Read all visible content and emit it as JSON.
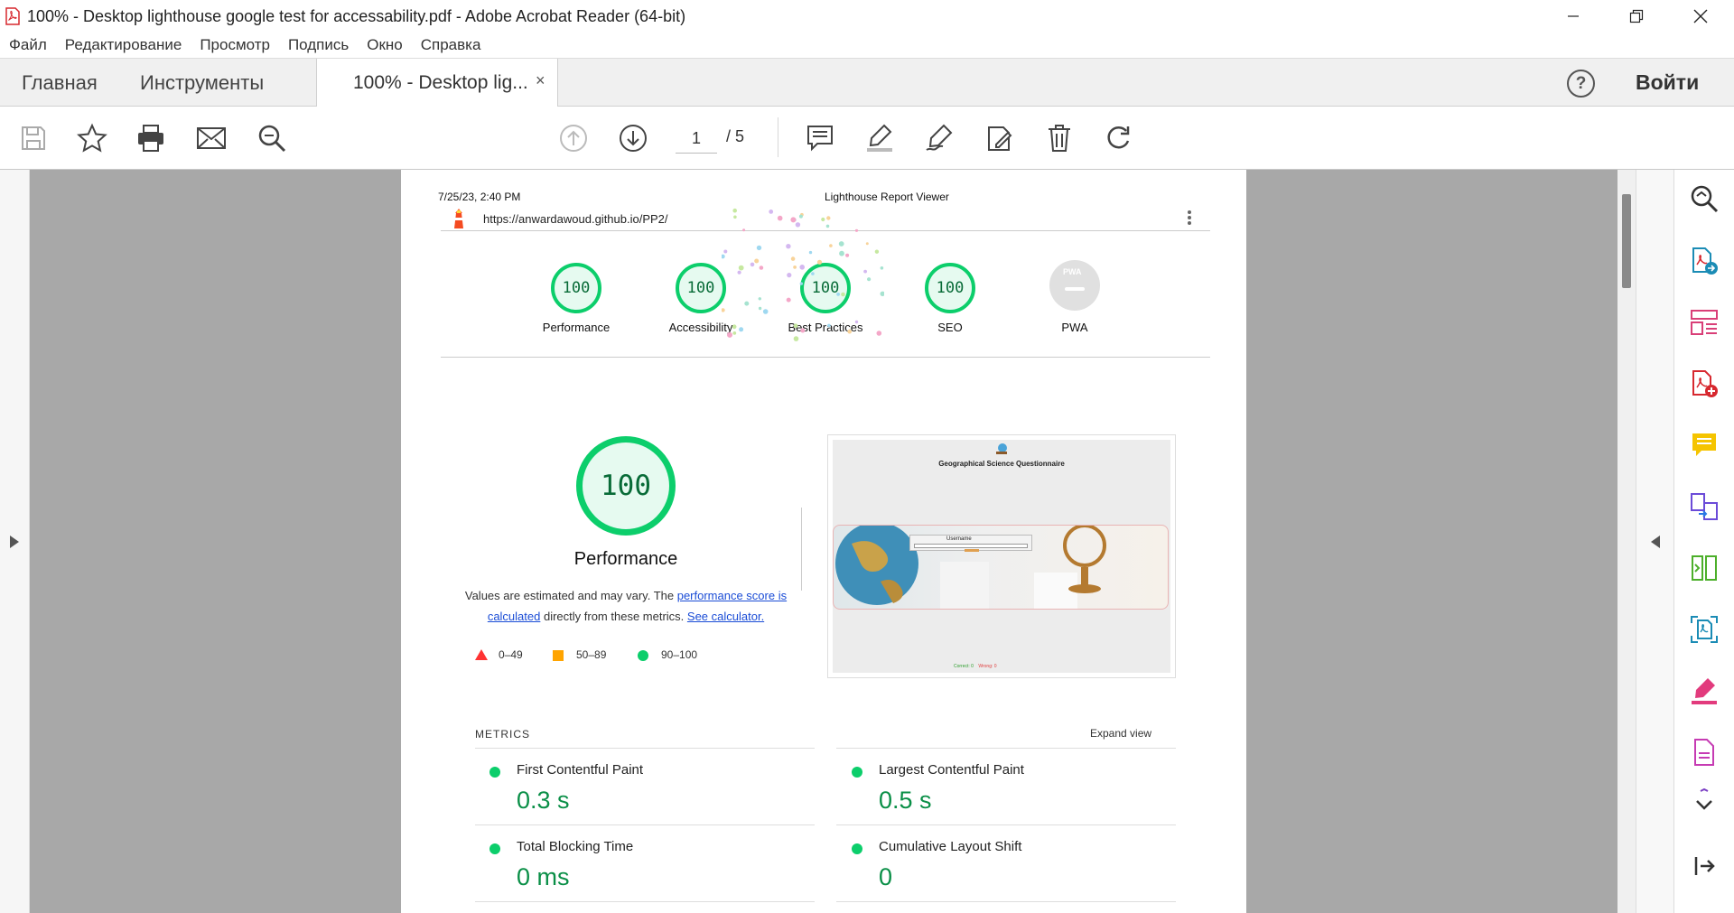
{
  "window": {
    "title": "100% - Desktop lighthouse google test for accessability.pdf - Adobe Acrobat Reader (64-bit)"
  },
  "menu": [
    "Файл",
    "Редактирование",
    "Просмотр",
    "Подпись",
    "Окно",
    "Справка"
  ],
  "tabs": {
    "home": "Главная",
    "tools": "Инструменты",
    "doc": "100% - Desktop lig...",
    "close": "×",
    "help": "?",
    "signin": "Войти"
  },
  "toolbar": {
    "page_current": "1",
    "page_total": "/ 5"
  },
  "report": {
    "date": "7/25/23, 2:40 PM",
    "viewer": "Lighthouse Report Viewer",
    "url": "https://anwardawoud.github.io/PP2/",
    "categories": [
      {
        "score": "100",
        "label": "Performance"
      },
      {
        "score": "100",
        "label": "Accessibility"
      },
      {
        "score": "100",
        "label": "Best Practices"
      },
      {
        "score": "100",
        "label": "SEO"
      }
    ],
    "pwa_label": "PWA",
    "pwa_badge": "PWA",
    "perf_score": "100",
    "perf_title": "Performance",
    "desc_1": "Values are estimated and may vary. The ",
    "desc_link1": "performance score is calculated",
    "desc_2": " directly from these metrics. ",
    "desc_link2": "See calculator.",
    "legend": [
      "0–49",
      "50–89",
      "90–100"
    ],
    "screenshot_title": "Geographical Science Questionnaire",
    "screenshot_field": "Username",
    "screenshot_footer_1": "Correct: 0",
    "screenshot_footer_2": "Wrong: 0",
    "metrics_heading": "METRICS",
    "expand": "Expand view",
    "metrics": [
      {
        "name": "First Contentful Paint",
        "value": "0.3 s"
      },
      {
        "name": "Largest Contentful Paint",
        "value": "0.5 s"
      },
      {
        "name": "Total Blocking Time",
        "value": "0 ms"
      },
      {
        "name": "Cumulative Layout Shift",
        "value": "0"
      }
    ]
  },
  "colors": {
    "pass": "#0cce6b",
    "average": "#ffa400",
    "fail": "#ff3333",
    "acrobat_red": "#d7282f",
    "gray_bg": "#a8a8a8"
  }
}
